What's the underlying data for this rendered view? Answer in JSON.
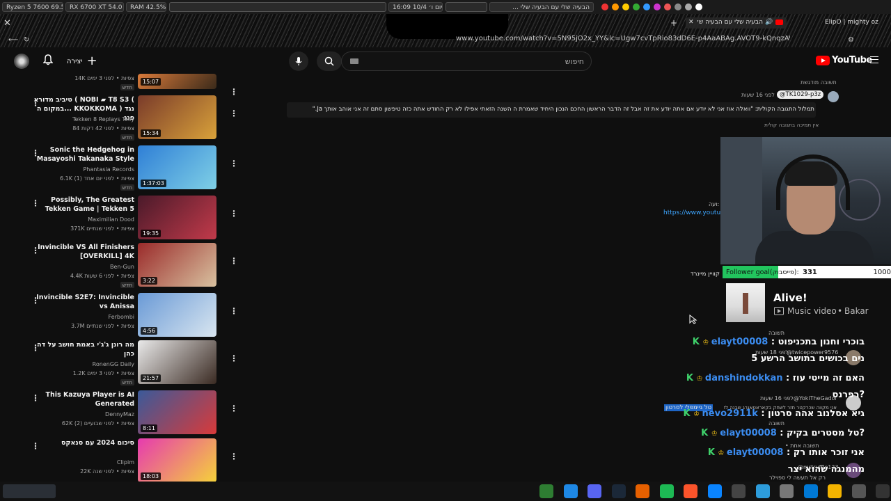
{
  "status_bar": {
    "cpu": "Ryzen 5 7600   69.5 °C",
    "gpu": "RX 6700 XT  54.0 °C",
    "ram": "RAM    42.5%",
    "clock": "16:09  יום ו׳  10/4",
    "now_playing": "הבעיה שלי עם הבעיה שלי ...",
    "tray_colors": [
      "#e33",
      "#f90",
      "#fc0",
      "#3a3",
      "#39f",
      "#c3c",
      "#e55",
      "#888",
      "#aaa",
      "#fff"
    ]
  },
  "browser": {
    "tab_title": "הבעיה שלי עם הבעיה שלי",
    "profile_text": "ElipO | mighty oz",
    "url": "www.youtube.com/watch?v=5N95jO2x_YY&lc=Ugw7cvTpRio83dD6E-p4AaABAg.AVOT9-kQnqzAVOcv7AmQXP"
  },
  "header": {
    "logo_text": "YouTube",
    "search_placeholder": "חיפוש",
    "create_label": "יצירה",
    "accent": "#ff0000"
  },
  "sidebar_videos": [
    {
      "title": "",
      "channel": "",
      "meta": "14K צפיות • לפני 3 ימים",
      "badge": "חדש",
      "duration": "15:07",
      "colors": [
        "#d97a3a",
        "#3a2a1a"
      ]
    },
    {
      "title": "טיביב מדורא ( NOBI ▰ T8 S3 ( במקום ה... KKOKKOMA נגד ( פנג",
      "channel": "Tekken 8 Replays Telly",
      "meta": "84 צפיות • לפני 42 דקות",
      "badge": "חדש",
      "duration": "15:34",
      "colors": [
        "#7a3b2a",
        "#d9a23a"
      ]
    },
    {
      "title": "Sonic the Hedgehog in Masayoshi Takanaka Style",
      "channel": "Phantasia Records",
      "meta": "6.1K צפיות • לפני יום אחד (1)",
      "badge": "חדש",
      "duration": "1:37:03",
      "colors": [
        "#2f7fd6",
        "#7fd0e6"
      ]
    },
    {
      "title": "Possibly, The Greatest Tekken Game | Tekken 5",
      "channel": "Maximilian Dood",
      "meta": "371K צפיות • לפני שנתיים",
      "badge": "",
      "duration": "19:35",
      "colors": [
        "#4a1a2a",
        "#c23a4a"
      ]
    },
    {
      "title": "Invincible VS All Finishers [OVERKILL] 4K",
      "channel": "Ben-Gun",
      "meta": "4.4K צפיות • לפני 6 שעות",
      "badge": "חדש",
      "duration": "3:22",
      "colors": [
        "#9a2a2a",
        "#d9c2a0"
      ]
    },
    {
      "title": "Invincible S2E7: Invincible vs Anissa",
      "channel": "Ferbombi",
      "meta": "3.7M צפיות • לפני שנתיים",
      "badge": "",
      "duration": "4:56",
      "colors": [
        "#6a9ad6",
        "#d9e6f0"
      ]
    },
    {
      "title": "מה רונן ג'ג'י באמת חושב על דה כהן",
      "channel": "RonenGG Daily",
      "meta": "1.2K צפיות • לפני 3 ימים",
      "badge": "חדש",
      "duration": "21:57",
      "colors": [
        "#eaeaea",
        "#3a2a22"
      ]
    },
    {
      "title": "This Kazuya Player is AI Generated",
      "channel": "DennyMaz",
      "meta": "62K צפיות • לפני שבועיים (2)",
      "badge": "",
      "duration": "8:11",
      "colors": [
        "#3a5a9a",
        "#d93a3a"
      ]
    },
    {
      "title": "סיכום 2024 עם סנאקס",
      "channel": "Clipim",
      "meta": "22K צפיות • לפני שנה",
      "badge": "",
      "duration": "18:03",
      "colors": [
        "#e63ab0",
        "#f5d23a"
      ]
    }
  ],
  "comment": {
    "highlight_label": "תשובה מודגשת",
    "author": "@TK1029-p3z",
    "time": "לפני 16 שעות",
    "text": "תמלול התגובה הקולית: \"וואלה אוז אני לא יודע אם אתה יודע את זה אבל זה הדבר הראשון החכם הנכון היחיד שאמרת ה השנה הזאתי אפילו לא רק החודש אתה כזה טיפשון סתם זה אני אוהב אותך Ja.\"",
    "no_support": "אין תמיכה בתגובה קולית",
    "link_label": "ועה:",
    "link_url": "https://www.youtub",
    "side_text": "קוויין מיינרד",
    "selected_text": "טל גיימפלי לסרטון"
  },
  "overlay": {
    "follower_goal_label": "Follower goal(פייסבוק):",
    "follower_current": "331",
    "follower_target": "1000",
    "follower_progress": 0.331,
    "music_title": "Alive!",
    "music_type": "Music video",
    "music_artist": "Bakar"
  },
  "chat": [
    {
      "user": "elayt00008",
      "text": "בוכרי וחנון בתכניפוט"
    },
    {
      "user": "",
      "text": "נים בכושים בתושב הרשע 5"
    },
    {
      "user": "danshindokkan",
      "text": "האם זה מייטי עוז"
    },
    {
      "user": "",
      "text": "רפרנס?"
    },
    {
      "user": "nevo2911k",
      "text": "גיא אסלנוב אהה סרטון"
    },
    {
      "user": "elayt00008",
      "text": "טל מסטרים בקיק?"
    },
    {
      "user": "elayt00008",
      "text": "אני זוכר אותו רק"
    },
    {
      "user": "",
      "text": "מהמנגה שהוא יצר"
    }
  ],
  "chat_sub": {
    "reply": "תשובה",
    "user_a": "@twicepower9576",
    "time_a": "לפני 18 שעות",
    "user_b": "@YokiTheGadol",
    "time_b": "לפני 16 שעות",
    "note_b": "אני מקווה שכרקטר חזר לשחק בקאראטאגרג שבנה לדיב חני כשחזור",
    "one_reply": "• תשובה אחת",
    "user_c": "@mrtruffle123",
    "note_c": "רק אל תעשה לי ספוילר"
  },
  "taskbar": {
    "icons": [
      "terminal-icon",
      "windows-icon",
      "discord-icon",
      "steam-icon",
      "firefox-icon",
      "spotify-icon",
      "brave-icon",
      "browser-icon",
      "inkscape-icon",
      "stack-icon",
      "files-icon",
      "store-icon",
      "chrome-icon",
      "notes-icon",
      "desktop-icon"
    ],
    "colors": [
      "#2e7d32",
      "#1e88e5",
      "#5865f2",
      "#1b2838",
      "#e66000",
      "#1db954",
      "#fb542b",
      "#0a84ff",
      "#444",
      "#2d9cdb",
      "#777",
      "#0078d4",
      "#f4b400",
      "#555",
      "#333"
    ]
  }
}
